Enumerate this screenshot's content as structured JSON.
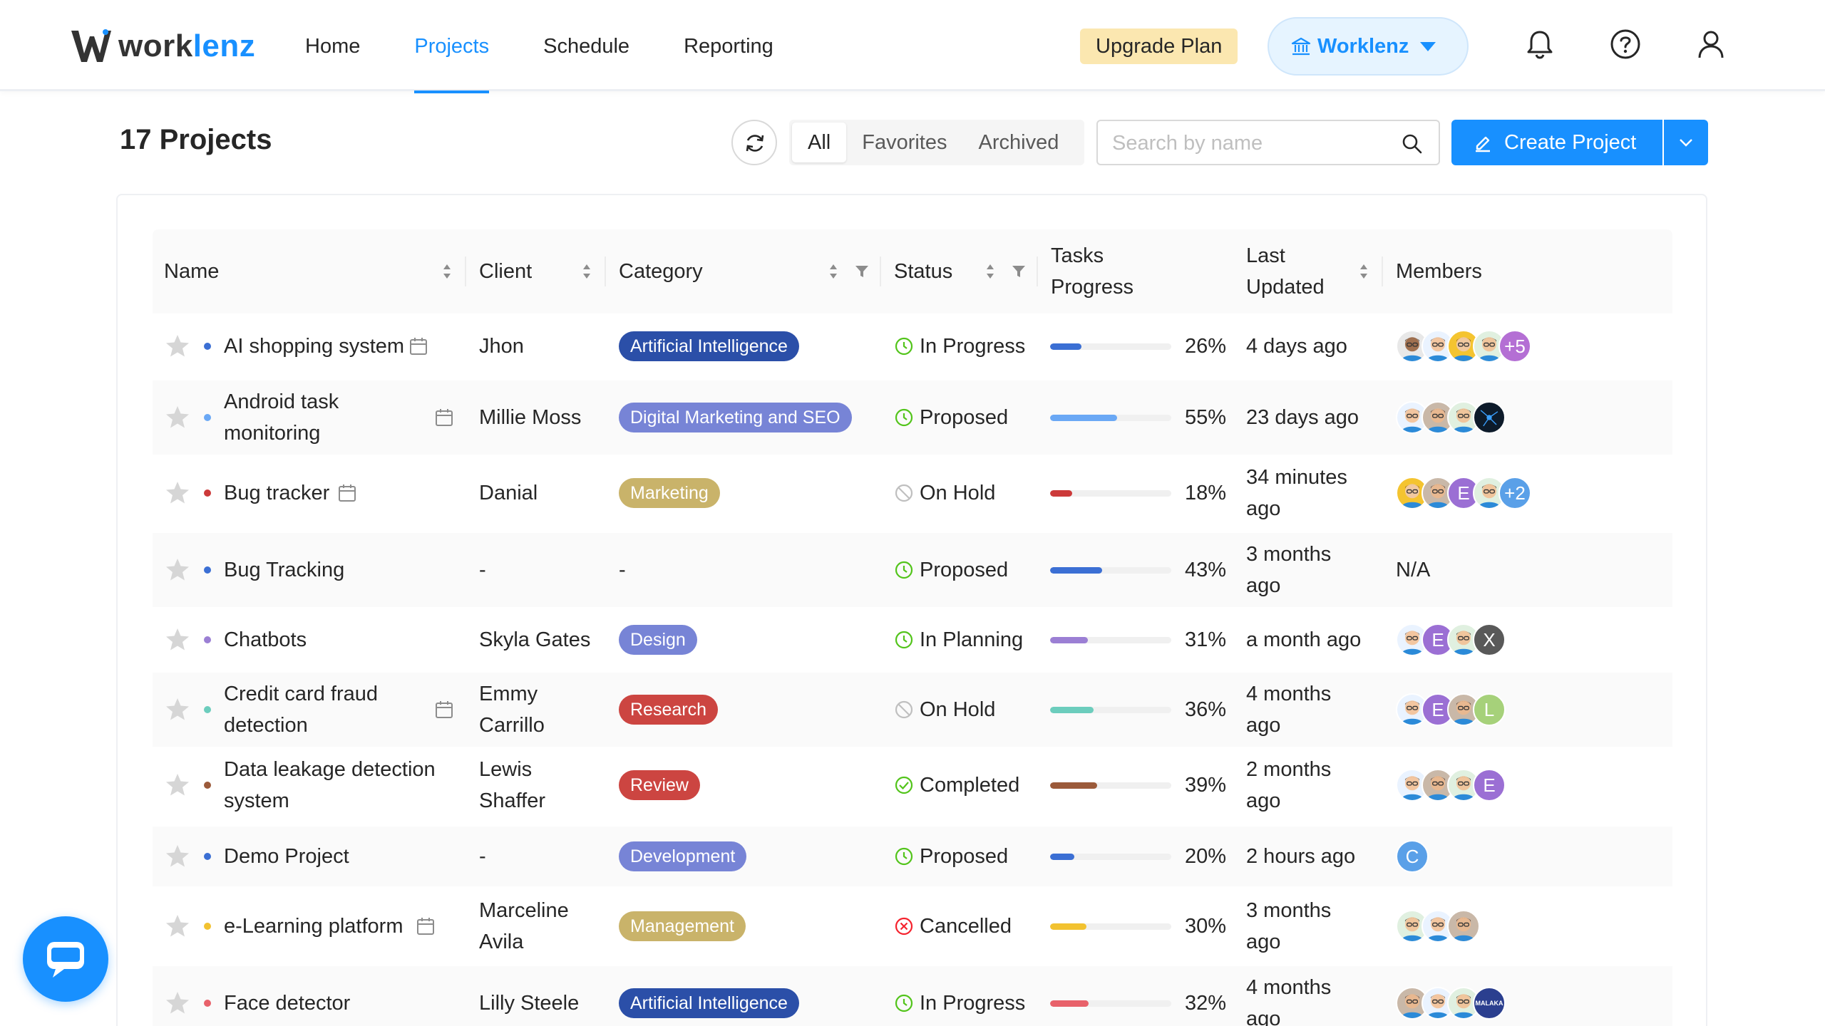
{
  "brand": {
    "name_main": "work",
    "name_accent": "lenz"
  },
  "nav": {
    "items": [
      "Home",
      "Projects",
      "Schedule",
      "Reporting"
    ],
    "active": "Projects"
  },
  "header_actions": {
    "upgrade_label": "Upgrade Plan",
    "workspace_label": "Worklenz"
  },
  "page": {
    "title": "17 Projects"
  },
  "filters": {
    "segments": [
      "All",
      "Favorites",
      "Archived"
    ],
    "active": "All"
  },
  "search": {
    "placeholder": "Search by name"
  },
  "create": {
    "label": "Create Project"
  },
  "columns": {
    "name": "Name",
    "client": "Client",
    "category": "Category",
    "status": "Status",
    "progress_l1": "Tasks",
    "progress_l2": "Progress",
    "updated_l1": "Last",
    "updated_l2": "Updated",
    "members": "Members"
  },
  "colors": {
    "primary": "#1890ff",
    "cat_ai": "#2b4fa8",
    "cat_dm": "#7784d6",
    "cat_marketing": "#c9b36a",
    "cat_design": "#7784d6",
    "cat_research": "#cc4541",
    "cat_review": "#cc4541",
    "cat_dev": "#7784d6",
    "cat_mgmt": "#c9b36a"
  },
  "projects": [
    {
      "name_l1": "AI shopping system",
      "name_l2": "",
      "client_l1": "Jhon",
      "client_l2": "",
      "category": "Artificial Intelligence",
      "status": "In Progress",
      "status_icon": "clock-icon",
      "progress": 26,
      "progress_label": "26%",
      "updated_l1": "4 days ago",
      "updated_l2": "",
      "bar_color": "#3b6fd4",
      "dot_color": "#3b6fd4",
      "members_extra": "+5",
      "members_na": ""
    },
    {
      "name_l1": "Android task",
      "name_l2": "monitoring",
      "client_l1": "Millie Moss",
      "client_l2": "",
      "category": "Digital Marketing and SEO",
      "status": "Proposed",
      "status_icon": "clock-icon",
      "progress": 55,
      "progress_label": "55%",
      "updated_l1": "23 days ago",
      "updated_l2": "",
      "bar_color": "#6aa8f5",
      "dot_color": "#6aa8f5",
      "members_extra": "",
      "members_na": ""
    },
    {
      "name_l1": "Bug tracker",
      "name_l2": "",
      "client_l1": "Danial",
      "client_l2": "",
      "category": "Marketing",
      "status": "On Hold",
      "status_icon": "ban-icon",
      "progress": 18,
      "progress_label": "18%",
      "updated_l1": "34 minutes",
      "updated_l2": "ago",
      "bar_color": "#cc3a3a",
      "dot_color": "#cc3a3a",
      "members_extra": "+2",
      "members_na": ""
    },
    {
      "name_l1": "Bug Tracking",
      "name_l2": "",
      "client_l1": "-",
      "client_l2": "",
      "category": "-",
      "status": "Proposed",
      "status_icon": "clock-icon",
      "progress": 43,
      "progress_label": "43%",
      "updated_l1": "3 months",
      "updated_l2": "ago",
      "bar_color": "#3b6fd4",
      "dot_color": "#3b6fd4",
      "members_extra": "",
      "members_na": "N/A"
    },
    {
      "name_l1": "Chatbots",
      "name_l2": "",
      "client_l1": "Skyla Gates",
      "client_l2": "",
      "category": "Design",
      "status": "In Planning",
      "status_icon": "clock-icon",
      "progress": 31,
      "progress_label": "31%",
      "updated_l1": "a month ago",
      "updated_l2": "",
      "bar_color": "#9b7fd4",
      "dot_color": "#9b7fd4",
      "members_extra": "",
      "members_na": ""
    },
    {
      "name_l1": "Credit card fraud",
      "name_l2": "detection",
      "client_l1": "Emmy",
      "client_l2": "Carrillo",
      "category": "Research",
      "status": "On Hold",
      "status_icon": "ban-icon",
      "progress": 36,
      "progress_label": "36%",
      "updated_l1": "4 months",
      "updated_l2": "ago",
      "bar_color": "#6ccdbd",
      "dot_color": "#6ccdbd",
      "members_extra": "",
      "members_na": ""
    },
    {
      "name_l1": "Data leakage detection",
      "name_l2": "system",
      "client_l1": "Lewis",
      "client_l2": "Shaffer",
      "category": "Review",
      "status": "Completed",
      "status_icon": "check-circle-icon",
      "progress": 39,
      "progress_label": "39%",
      "updated_l1": "2 months",
      "updated_l2": "ago",
      "bar_color": "#9b5a3a",
      "dot_color": "#9b5a3a",
      "members_extra": "",
      "members_na": ""
    },
    {
      "name_l1": "Demo Project",
      "name_l2": "",
      "client_l1": "-",
      "client_l2": "",
      "category": "Development",
      "status": "Proposed",
      "status_icon": "clock-icon",
      "progress": 20,
      "progress_label": "20%",
      "updated_l1": "2 hours ago",
      "updated_l2": "",
      "bar_color": "#3b6fd4",
      "dot_color": "#3b6fd4",
      "members_extra": "",
      "members_na": ""
    },
    {
      "name_l1": "e-Learning platform",
      "name_l2": "",
      "client_l1": "Marceline",
      "client_l2": "Avila",
      "category": "Management",
      "status": "Cancelled",
      "status_icon": "x-circle-icon",
      "progress": 30,
      "progress_label": "30%",
      "updated_l1": "3 months",
      "updated_l2": "ago",
      "bar_color": "#f2c230",
      "dot_color": "#f2c230",
      "members_extra": "",
      "members_na": ""
    },
    {
      "name_l1": "Face detector",
      "name_l2": "",
      "client_l1": "Lilly Steele",
      "client_l2": "",
      "category": "Artificial Intelligence",
      "status": "In Progress",
      "status_icon": "clock-icon",
      "progress": 32,
      "progress_label": "32%",
      "updated_l1": "4 months",
      "updated_l2": "ago",
      "bar_color": "#e8616a",
      "dot_color": "#e8616a",
      "members_extra": "",
      "members_na": ""
    }
  ],
  "member_initials": {
    "e": "E",
    "x": "X",
    "l": "L",
    "c": "C"
  },
  "member_badge": "MALAKA"
}
